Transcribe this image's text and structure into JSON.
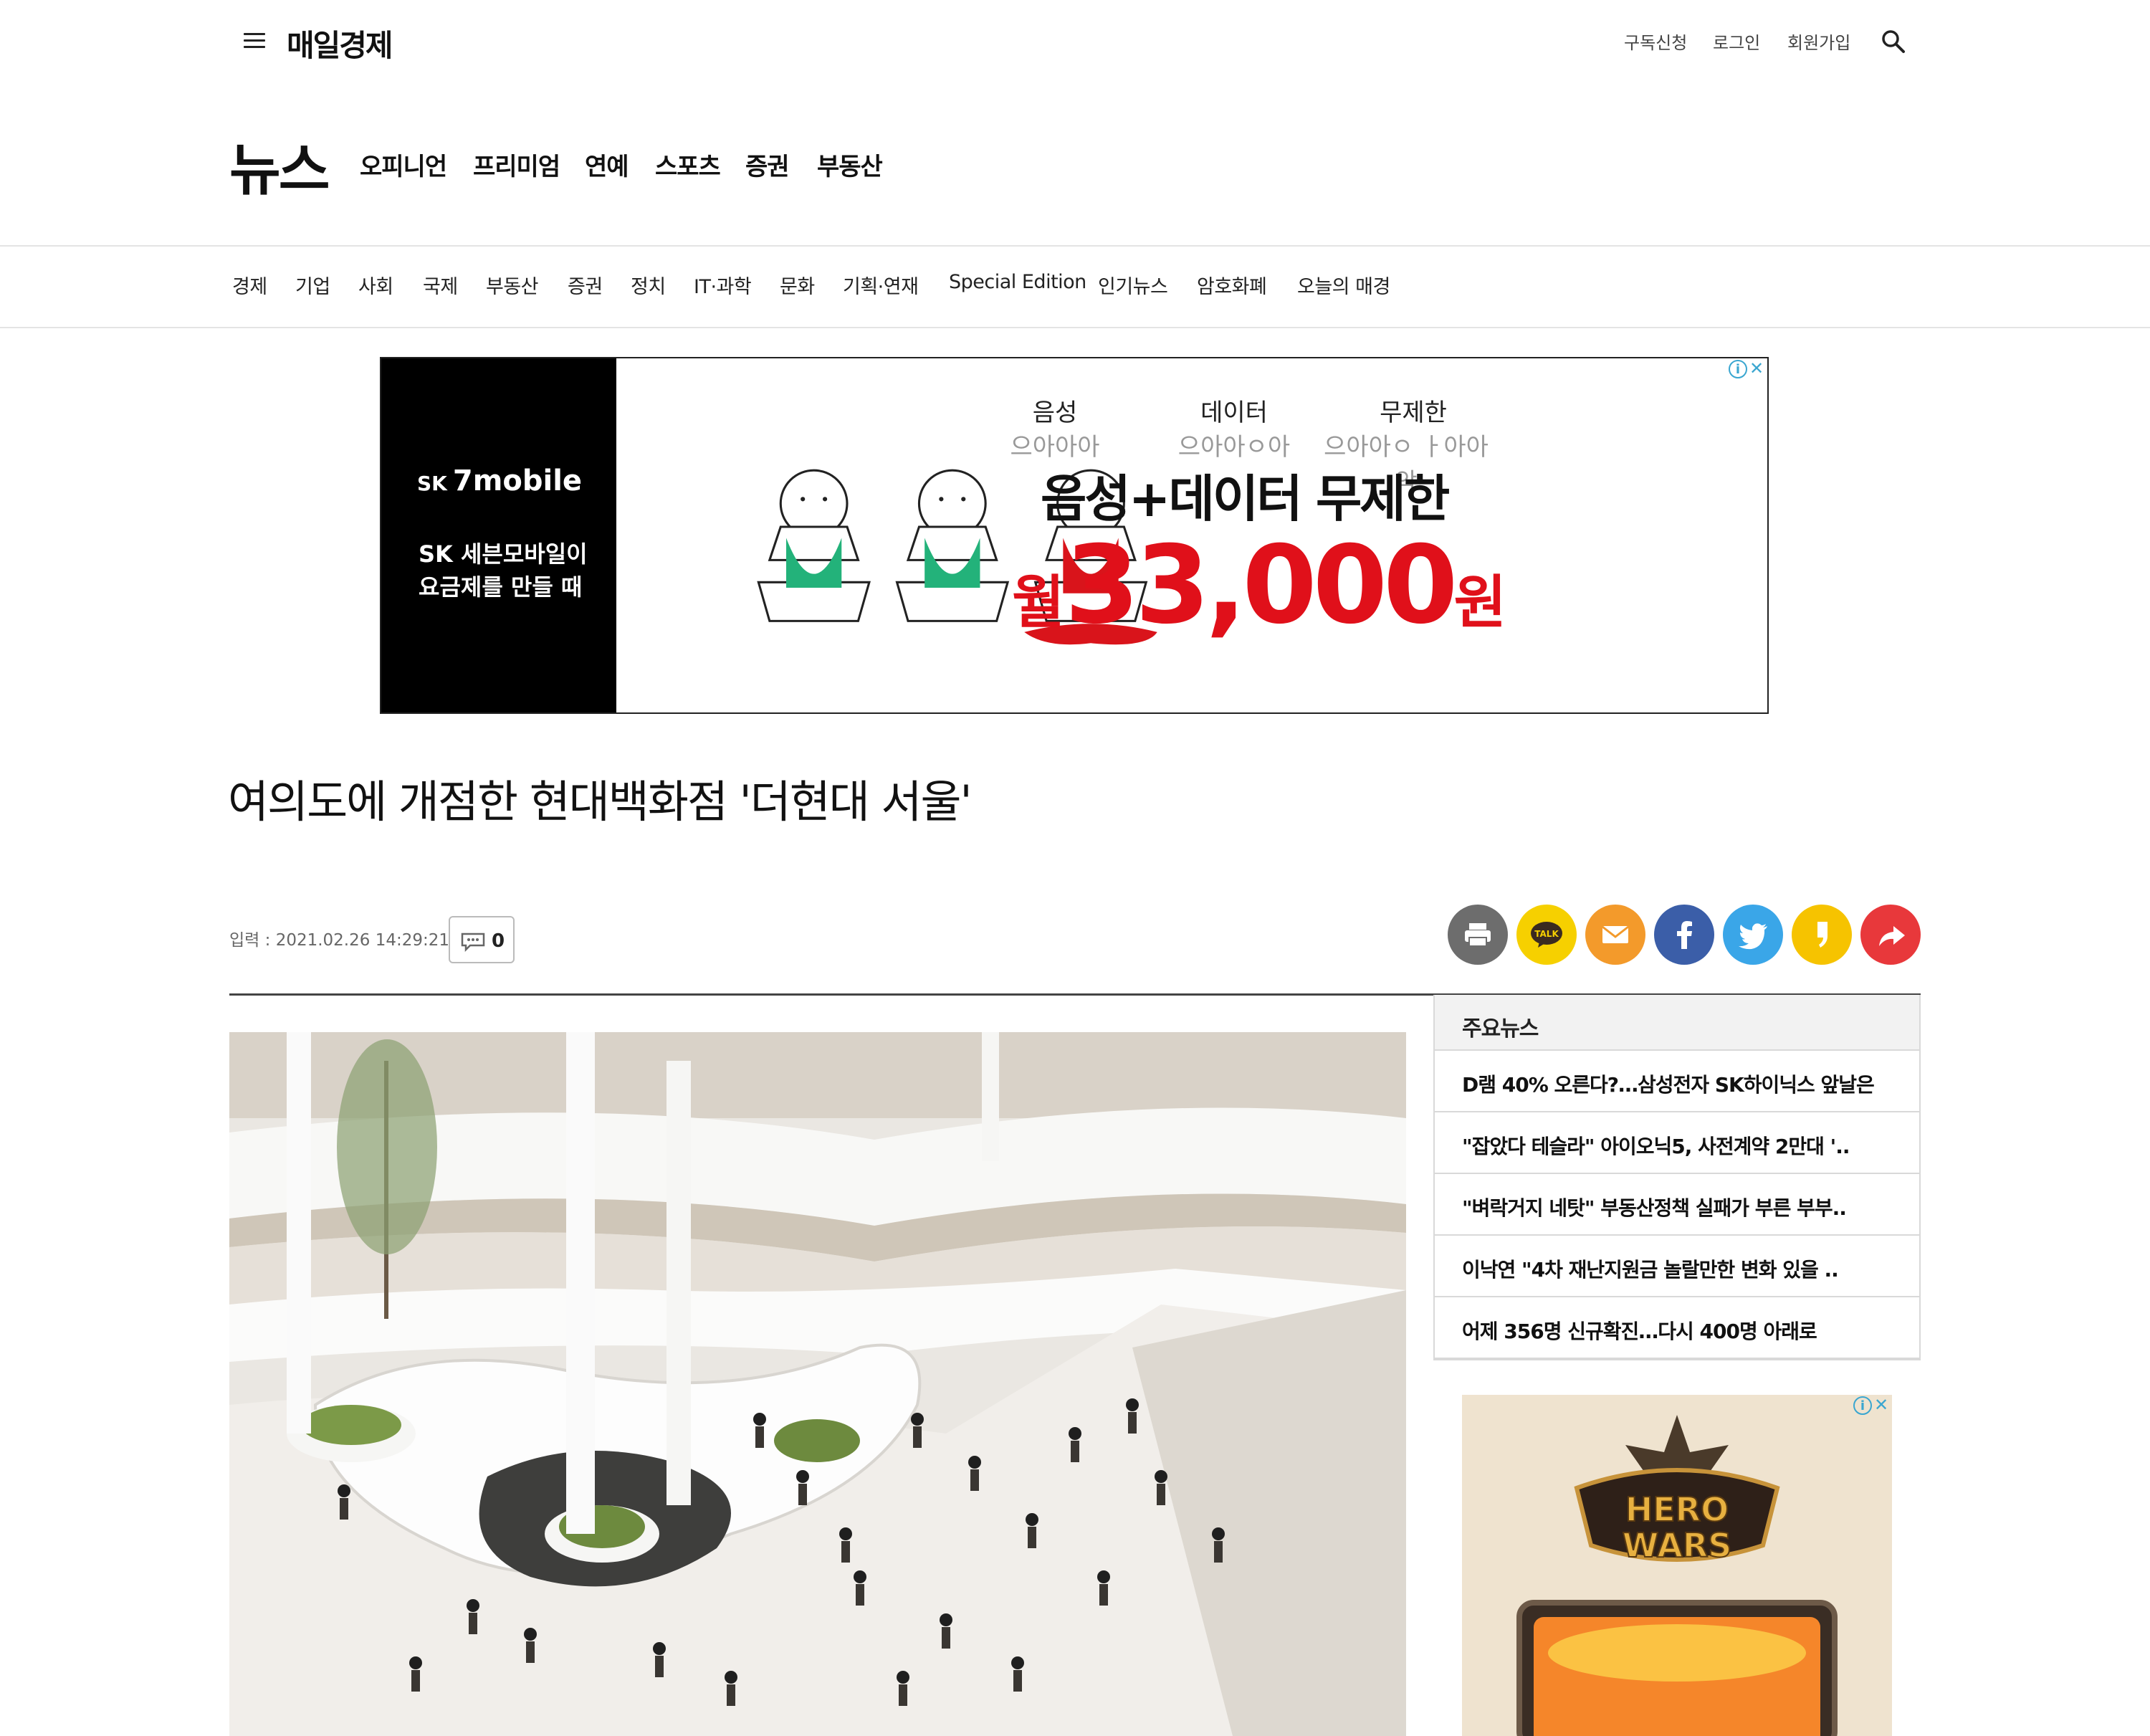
{
  "header": {
    "logo": "매일경제",
    "utility_links": [
      "구독신청",
      "로그인",
      "회원가입"
    ]
  },
  "section": {
    "title": "뉴스",
    "nav": [
      "오피니언",
      "프리미엄",
      "연예",
      "스포츠",
      "증권",
      "부동산"
    ]
  },
  "category_nav": [
    "경제",
    "기업",
    "사회",
    "국제",
    "부동산",
    "증권",
    "정치",
    "IT·과학",
    "문화",
    "기획·연재",
    "Special Edition",
    "인기뉴스",
    "암호화폐",
    "오늘의 매경"
  ],
  "top_ad": {
    "brand_prefix": "SK",
    "brand": "7mobile",
    "copy_line1": "SK 세븐모바일이",
    "copy_line2": "요금제를 만들 때",
    "labels": [
      "음성",
      "데이터",
      "무제한"
    ],
    "sublabels": [
      "으아아아",
      "으아아ㅇ아",
      "으아아ㅇ ㅏ아아악"
    ],
    "headline": "음성+데이터 무제한",
    "price_prefix": "월",
    "price": "33,000",
    "price_suffix": "원"
  },
  "article": {
    "headline": "여의도에 개점한 현대백화점 '더현대 서울'",
    "byline": "입력 : 2021.02.26 14:29:21",
    "comment_count": "0"
  },
  "share_buttons": [
    {
      "name": "print",
      "color": "#6d6d6d"
    },
    {
      "name": "kakaotalk",
      "color": "#f6d000"
    },
    {
      "name": "email",
      "color": "#f39a2b"
    },
    {
      "name": "facebook",
      "color": "#3b5ea8"
    },
    {
      "name": "twitter",
      "color": "#3aa6e8"
    },
    {
      "name": "kakaostory",
      "color": "#f6c300"
    },
    {
      "name": "share",
      "color": "#e8383b"
    }
  ],
  "sidebar": {
    "title": "주요뉴스",
    "items": [
      "D램 40% 오른다?…삼성전자 SK하이닉스 앞날은",
      "\"잡았다 테슬라\" 아이오닉5, 사전계약 2만대 '..",
      "\"벼락거지 네탓\" 부동산정책 실패가 부른 부부..",
      "이낙연 \"4차 재난지원금 놀랄만한 변화 있을 ..",
      "어제 356명 신규확진…다시 400명 아래로"
    ]
  },
  "side_ad": {
    "logo_line1": "HERO",
    "logo_line2": "WARS"
  }
}
